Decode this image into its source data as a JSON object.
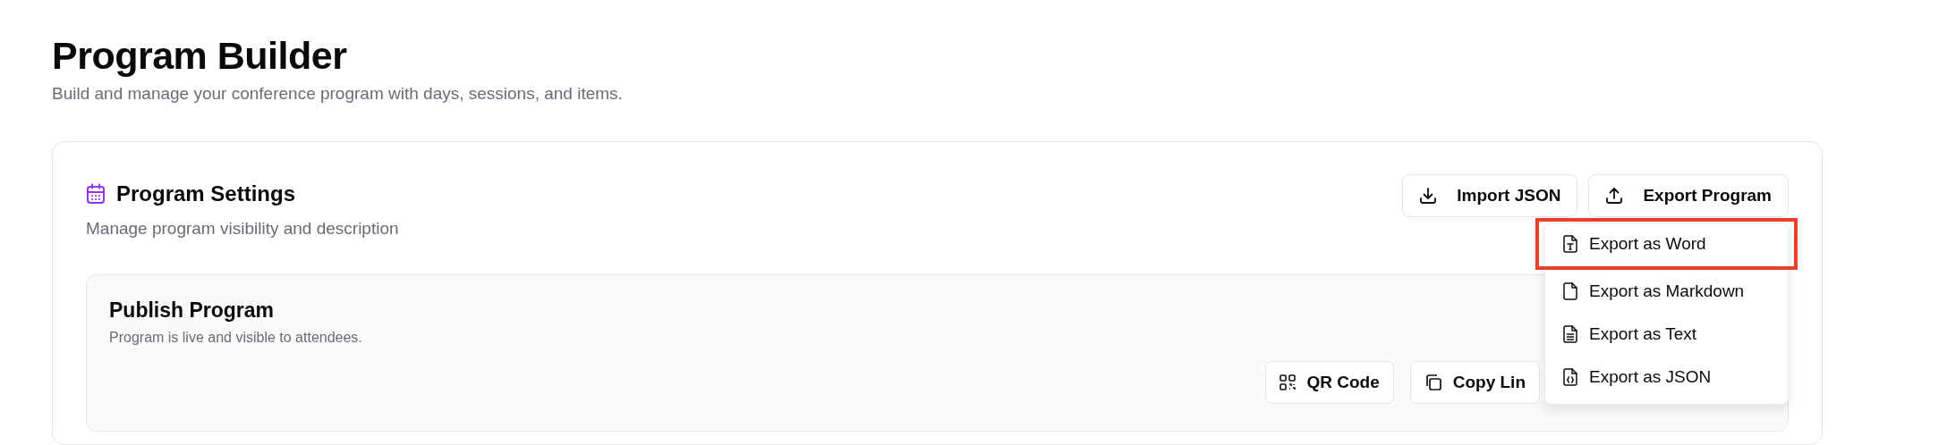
{
  "page": {
    "title": "Program Builder",
    "subtitle": "Build and manage your conference program with days, sessions, and items."
  },
  "settings": {
    "title": "Program Settings",
    "description": "Manage program visibility and description",
    "actions": [
      {
        "label": "Import JSON",
        "kind": "import"
      },
      {
        "label": "Export Program",
        "kind": "export"
      }
    ],
    "export_menu": {
      "expanded": true,
      "items": [
        {
          "label": "Export as Word",
          "kind": "word",
          "highlighted": true
        },
        {
          "label": "Export as Markdown",
          "kind": "markdown",
          "highlighted": false
        },
        {
          "label": "Export as Text",
          "kind": "text",
          "highlighted": false
        },
        {
          "label": "Export as JSON",
          "kind": "json",
          "highlighted": false
        }
      ]
    },
    "publish": {
      "title": "Publish Program",
      "status": "Program is live and visible to attendees.",
      "buttons": [
        {
          "label": "QR Code",
          "kind": "qr"
        },
        {
          "label": "Copy Lin",
          "kind": "copy"
        }
      ]
    }
  }
}
